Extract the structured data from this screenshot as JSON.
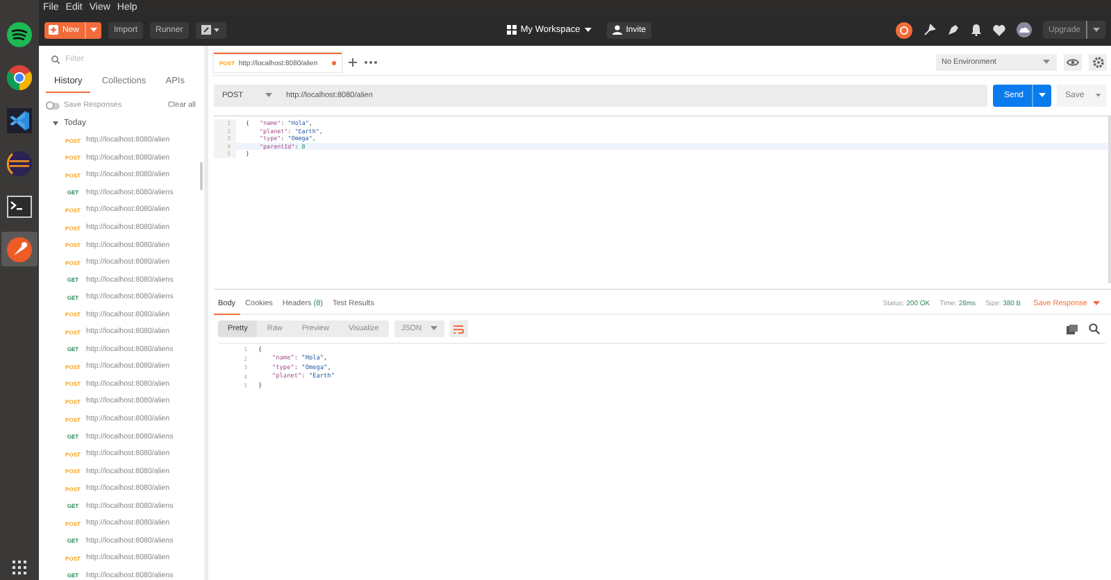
{
  "menu_bar": {
    "items": [
      "File",
      "Edit",
      "View",
      "Help"
    ]
  },
  "dock": {
    "apps": [
      {
        "kind": "music",
        "selected": false
      },
      {
        "kind": "browser",
        "selected": false
      },
      {
        "kind": "editor",
        "selected": false
      },
      {
        "kind": "ide",
        "selected": false
      },
      {
        "kind": "terminal",
        "selected": false
      },
      {
        "kind": "postman",
        "selected": true
      }
    ]
  },
  "header": {
    "new_button": "New",
    "import_button": "Import",
    "runner_button": "Runner",
    "workspace": "My Workspace",
    "invite_button": "Invite",
    "upgrade_button": "Upgrade"
  },
  "sidebar": {
    "filter": {
      "placeholder": "Filter"
    },
    "tabs": [
      {
        "label": "History",
        "selected": true
      },
      {
        "label": "Collections",
        "selected": false
      },
      {
        "label": "APIs",
        "selected": false
      }
    ],
    "save_responses": {
      "label": "Save Responses",
      "on": false
    },
    "clear_all": "Clear all",
    "group": {
      "label": "Today",
      "expanded": true,
      "items": [
        {
          "method": "POST",
          "color": "#f4a21c",
          "url": "http://localhost:8080/alien"
        },
        {
          "method": "POST",
          "color": "#f4a21c",
          "url": "http://localhost:8080/alien"
        },
        {
          "method": "POST",
          "color": "#f4a21c",
          "url": "http://localhost:8080/alien"
        },
        {
          "method": "GET",
          "color": "#2f8a5b",
          "url": "http://localhost:8080/aliens"
        },
        {
          "method": "POST",
          "color": "#f4a21c",
          "url": "http://localhost:8080/alien"
        },
        {
          "method": "POST",
          "color": "#f4a21c",
          "url": "http://localhost:8080/alien"
        },
        {
          "method": "POST",
          "color": "#f4a21c",
          "url": "http://localhost:8080/alien"
        },
        {
          "method": "POST",
          "color": "#f4a21c",
          "url": "http://localhost:8080/alien"
        },
        {
          "method": "GET",
          "color": "#2f8a5b",
          "url": "http://localhost:8080/aliens"
        },
        {
          "method": "GET",
          "color": "#2f8a5b",
          "url": "http://localhost:8080/aliens"
        },
        {
          "method": "POST",
          "color": "#f4a21c",
          "url": "http://localhost:8080/alien"
        },
        {
          "method": "POST",
          "color": "#f4a21c",
          "url": "http://localhost:8080/alien"
        },
        {
          "method": "GET",
          "color": "#2f8a5b",
          "url": "http://localhost:8080/aliens"
        },
        {
          "method": "POST",
          "color": "#f4a21c",
          "url": "http://localhost:8080/alien"
        },
        {
          "method": "POST",
          "color": "#f4a21c",
          "url": "http://localhost:8080/alien"
        },
        {
          "method": "POST",
          "color": "#f4a21c",
          "url": "http://localhost:8080/alien"
        },
        {
          "method": "POST",
          "color": "#f4a21c",
          "url": "http://localhost:8080/alien"
        },
        {
          "method": "GET",
          "color": "#2f8a5b",
          "url": "http://localhost:8080/aliens"
        },
        {
          "method": "POST",
          "color": "#f4a21c",
          "url": "http://localhost:8080/alien"
        },
        {
          "method": "POST",
          "color": "#f4a21c",
          "url": "http://localhost:8080/alien"
        },
        {
          "method": "POST",
          "color": "#f4a21c",
          "url": "http://localhost:8080/alien"
        },
        {
          "method": "GET",
          "color": "#2f8a5b",
          "url": "http://localhost:8080/aliens"
        },
        {
          "method": "POST",
          "color": "#f4a21c",
          "url": "http://localhost:8080/alien"
        },
        {
          "method": "GET",
          "color": "#2f8a5b",
          "url": "http://localhost:8080/aliens"
        },
        {
          "method": "POST",
          "color": "#f4a21c",
          "url": "http://localhost:8080/alien"
        },
        {
          "method": "GET",
          "color": "#2f8a5b",
          "url": "http://localhost:8080/aliens"
        }
      ]
    }
  },
  "request_tab": {
    "method": "POST",
    "url": "http://localhost:8080/alien",
    "unsaved": true,
    "selected": true
  },
  "environment": "No Environment",
  "request": {
    "method": "POST",
    "url": "http://localhost:8080/alien",
    "send_button": "Send",
    "save_button": "Save"
  },
  "request_body": {
    "lines": [
      {
        "number": "1",
        "current": false,
        "tokens": [
          {
            "kind": "punct",
            "text": "{   "
          },
          {
            "kind": "key",
            "text": "\"name\""
          },
          {
            "kind": "punct",
            "text": ": "
          },
          {
            "kind": "string",
            "text": "\"Hola\""
          },
          {
            "kind": "punct",
            "text": ","
          }
        ]
      },
      {
        "number": "2",
        "current": false,
        "indent": true,
        "tokens": [
          {
            "kind": "key",
            "text": "\"planet\""
          },
          {
            "kind": "punct",
            "text": ": "
          },
          {
            "kind": "string",
            "text": "\"Earth\""
          },
          {
            "kind": "punct",
            "text": ","
          }
        ]
      },
      {
        "number": "3",
        "current": false,
        "indent": true,
        "tokens": [
          {
            "kind": "key",
            "text": "\"type\""
          },
          {
            "kind": "punct",
            "text": ": "
          },
          {
            "kind": "string",
            "text": "\"Omega\""
          },
          {
            "kind": "punct",
            "text": ","
          }
        ]
      },
      {
        "number": "4",
        "current": true,
        "indent": true,
        "tokens": [
          {
            "kind": "key",
            "text": "\"parentId\""
          },
          {
            "kind": "punct",
            "text": ": "
          },
          {
            "kind": "number",
            "text": "8"
          }
        ]
      },
      {
        "number": "5",
        "current": false,
        "tokens": [
          {
            "kind": "punct",
            "text": "}"
          }
        ]
      }
    ]
  },
  "response_tabs": [
    {
      "label": "Body",
      "selected": true
    },
    {
      "label": "Cookies",
      "selected": false
    },
    {
      "label": "Headers",
      "badge": "(8)",
      "selected": false
    },
    {
      "label": "Test Results",
      "selected": false
    }
  ],
  "response_meta": [
    {
      "label": "Status:",
      "value": "200 OK"
    },
    {
      "label": "Time:",
      "value": "28ms"
    },
    {
      "label": "Size:",
      "value": "380 B"
    }
  ],
  "save_response": "Save Response",
  "view_modes": [
    {
      "label": "Pretty",
      "selected": true
    },
    {
      "label": "Raw",
      "selected": false
    },
    {
      "label": "Preview",
      "selected": false
    },
    {
      "label": "Visualize",
      "selected": false
    }
  ],
  "format": "JSON",
  "response_body": {
    "lines": [
      {
        "number": "1",
        "tokens": [
          {
            "kind": "punct",
            "text": "{"
          }
        ]
      },
      {
        "number": "2",
        "indent": true,
        "tokens": [
          {
            "kind": "key",
            "text": "\"name\""
          },
          {
            "kind": "punct",
            "text": ": "
          },
          {
            "kind": "string",
            "text": "\"Hola\""
          },
          {
            "kind": "punct",
            "text": ","
          }
        ]
      },
      {
        "number": "3",
        "indent": true,
        "tokens": [
          {
            "kind": "key",
            "text": "\"type\""
          },
          {
            "kind": "punct",
            "text": ": "
          },
          {
            "kind": "string",
            "text": "\"Omega\""
          },
          {
            "kind": "punct",
            "text": ","
          }
        ]
      },
      {
        "number": "4",
        "indent": true,
        "tokens": [
          {
            "kind": "key",
            "text": "\"planet\""
          },
          {
            "kind": "punct",
            "text": ": "
          },
          {
            "kind": "string",
            "text": "\"Earth\""
          }
        ]
      },
      {
        "number": "5",
        "tokens": [
          {
            "kind": "punct",
            "text": "}"
          }
        ]
      }
    ]
  }
}
